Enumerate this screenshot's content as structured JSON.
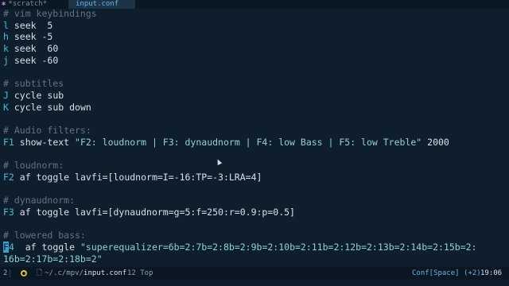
{
  "tabs": [
    {
      "icon": "✱",
      "label": "*scratch*"
    },
    {
      "label": "input.conf"
    }
  ],
  "lines": [
    [
      {
        "c": "comment",
        "t": "# vim keybindings"
      }
    ],
    [
      {
        "c": "key",
        "t": "l"
      },
      {
        "c": "txt",
        "t": " seek  5"
      }
    ],
    [
      {
        "c": "key",
        "t": "h"
      },
      {
        "c": "txt",
        "t": " seek -5"
      }
    ],
    [
      {
        "c": "key",
        "t": "k"
      },
      {
        "c": "txt",
        "t": " seek  60"
      }
    ],
    [
      {
        "c": "key",
        "t": "j"
      },
      {
        "c": "txt",
        "t": " seek -60"
      }
    ],
    [],
    [
      {
        "c": "comment",
        "t": "# subtitles"
      }
    ],
    [
      {
        "c": "key",
        "t": "J"
      },
      {
        "c": "txt",
        "t": " cycle sub"
      }
    ],
    [
      {
        "c": "key",
        "t": "K"
      },
      {
        "c": "txt",
        "t": " cycle sub down"
      }
    ],
    [],
    [
      {
        "c": "comment",
        "t": "# Audio filters:"
      }
    ],
    [
      {
        "c": "key",
        "t": "F1"
      },
      {
        "c": "txt",
        "t": " show-text "
      },
      {
        "c": "str",
        "t": "\"F2: loudnorm | F3: dynaudnorm | F4: low Bass | F5: low Treble\""
      },
      {
        "c": "num",
        "t": " 2000"
      }
    ],
    [],
    [
      {
        "c": "comment",
        "t": "# loudnorm:"
      }
    ],
    [
      {
        "c": "key",
        "t": "F2"
      },
      {
        "c": "txt",
        "t": " af toggle lavfi=[loudnorm=I=-16:TP=-3:LRA=4]"
      }
    ],
    [],
    [
      {
        "c": "comment",
        "t": "# dynaudnorm:"
      }
    ],
    [
      {
        "c": "key",
        "t": "F3"
      },
      {
        "c": "txt",
        "t": " af toggle lavfi=[dynaudnorm=g=5:f=250:r=0.9:p=0.5]"
      }
    ],
    [],
    [
      {
        "c": "comment",
        "t": "# lowered bass:"
      }
    ],
    [
      {
        "c": "cursor",
        "t": "F"
      },
      {
        "c": "key",
        "t": "4"
      },
      {
        "c": "txt",
        "t": "  af toggle "
      },
      {
        "c": "str",
        "t": "\"superequalizer=6b=2:7b=2:8b=2:9b=2:10b=2:11b=2:12b=2:13b=2:14b=2:15b=2: "
      }
    ],
    [
      {
        "c": "str",
        "t": "16b=2:17b=2:18b=2\""
      }
    ]
  ],
  "status": {
    "window_number": "2",
    "modified_icon": "●",
    "path": "~/.c/mpv/",
    "filename": "input.conf",
    "position": "12 Top",
    "mode": "Conf[Space] (+2)",
    "time": "19:06"
  }
}
